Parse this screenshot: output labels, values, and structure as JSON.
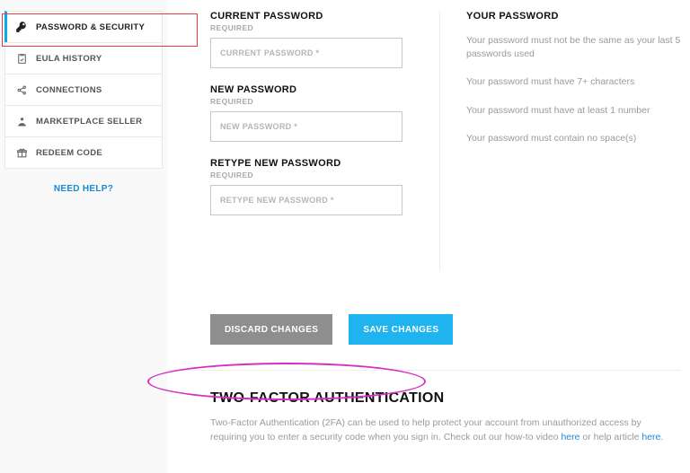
{
  "sidebar": {
    "items": [
      {
        "label": "PASSWORD & SECURITY",
        "icon": "key"
      },
      {
        "label": "EULA HISTORY",
        "icon": "clipboard"
      },
      {
        "label": "CONNECTIONS",
        "icon": "share"
      },
      {
        "label": "MARKETPLACE SELLER",
        "icon": "seller"
      },
      {
        "label": "REDEEM CODE",
        "icon": "gift"
      }
    ],
    "need_help": "NEED HELP?"
  },
  "form": {
    "current_password": {
      "label": "CURRENT PASSWORD",
      "required": "REQUIRED",
      "placeholder": "CURRENT PASSWORD *"
    },
    "new_password": {
      "label": "NEW PASSWORD",
      "required": "REQUIRED",
      "placeholder": "NEW PASSWORD *"
    },
    "retype_password": {
      "label": "RETYPE NEW PASSWORD",
      "required": "REQUIRED",
      "placeholder": "RETYPE NEW PASSWORD *"
    }
  },
  "info": {
    "title": "YOUR PASSWORD",
    "rule1": "Your password must not be the same as your last 5 passwords used",
    "rule2": "Your password must have 7+ characters",
    "rule3": "Your password must have at least 1 number",
    "rule4": "Your password must contain no space(s)"
  },
  "buttons": {
    "discard": "DISCARD CHANGES",
    "save": "SAVE CHANGES"
  },
  "twofa": {
    "title": "TWO-FACTOR AUTHENTICATION",
    "desc_part1": "Two-Factor Authentication (2FA) can be used to help protect your account from unauthorized access by requiring you to enter a security code when you sign in. Check out our how-to video ",
    "link1": "here",
    "desc_part2": " or help article ",
    "link2": "here",
    "desc_part3": "."
  }
}
